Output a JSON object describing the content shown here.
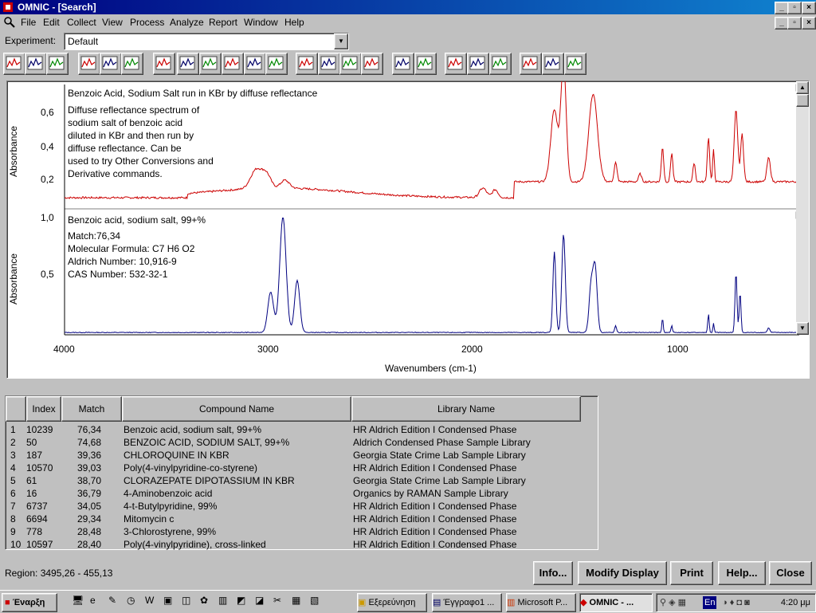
{
  "window": {
    "title": "OMNIC - [Search]"
  },
  "menu": [
    "File",
    "Edit",
    "Collect",
    "View",
    "Process",
    "Analyze",
    "Report",
    "Window",
    "Help"
  ],
  "experiment": {
    "label": "Experiment:",
    "value": "Default"
  },
  "spectrum_top": {
    "title": "Benzoic Acid, Sodium Salt run in KBr by diffuse reflectance",
    "description": [
      "Diffuse reflectance spectrum of",
      "sodium salt of benzoic acid",
      "diluted in KBr and then run by",
      "diffuse reflectance. Can be",
      "used to try Other Conversions and",
      "Derivative commands."
    ],
    "ylabel": "Absorbance",
    "yticks": [
      "0,6",
      "0,4",
      "0,2"
    ],
    "color": "#cc0000"
  },
  "spectrum_bottom": {
    "title": "Benzoic acid, sodium salt, 99+%",
    "match": "Match:76,34",
    "formula": "Molecular Formula:  C7 H6 O2",
    "aldrich": "Aldrich Number:  10,916-9",
    "cas": "CAS Number:  532-32-1",
    "ylabel": "Absorbance",
    "yticks": [
      "1,0",
      "0,5"
    ],
    "color": "#000080"
  },
  "xaxis": {
    "label": "Wavenumbers (cm-1)",
    "ticks": [
      "4000",
      "3000",
      "2000",
      "1000"
    ]
  },
  "table": {
    "headers": [
      "Index",
      "Match",
      "Compound Name",
      "Library Name"
    ],
    "rows": [
      {
        "n": "1",
        "index": "10239",
        "match": "76,34",
        "name": "Benzoic acid, sodium salt, 99+%",
        "lib": "HR Aldrich Edition I Condensed Phase"
      },
      {
        "n": "2",
        "index": "50",
        "match": "74,68",
        "name": "BENZOIC ACID, SODIUM SALT, 99+%",
        "lib": "Aldrich Condensed Phase Sample Library"
      },
      {
        "n": "3",
        "index": "187",
        "match": "39,36",
        "name": "CHLOROQUINE IN KBR",
        "lib": "Georgia State Crime Lab Sample Library"
      },
      {
        "n": "4",
        "index": "10570",
        "match": "39,03",
        "name": "Poly(4-vinylpyridine-co-styrene)",
        "lib": "HR Aldrich Edition I Condensed Phase"
      },
      {
        "n": "5",
        "index": "61",
        "match": "38,70",
        "name": "CLORAZEPATE DIPOTASSIUM IN KBR",
        "lib": "Georgia State Crime Lab Sample Library"
      },
      {
        "n": "6",
        "index": "16",
        "match": "36,79",
        "name": "4-Aminobenzoic acid",
        "lib": "Organics by RAMAN Sample Library"
      },
      {
        "n": "7",
        "index": "6737",
        "match": "34,05",
        "name": "4-t-Butylpyridine, 99%",
        "lib": "HR Aldrich Edition I Condensed Phase"
      },
      {
        "n": "8",
        "index": "6694",
        "match": "29,34",
        "name": "Mitomycin c",
        "lib": "HR Aldrich Edition I Condensed Phase"
      },
      {
        "n": "9",
        "index": "778",
        "match": "28,48",
        "name": "3-Chlorostyrene, 99%",
        "lib": "HR Aldrich Edition I Condensed Phase"
      },
      {
        "n": "10",
        "index": "10597",
        "match": "28,40",
        "name": "Poly(4-vinylpyridine), cross-linked",
        "lib": "HR Aldrich Edition I Condensed Phase"
      }
    ]
  },
  "region": "Region:  3495,26  -  455,13",
  "buttons": {
    "info": "Info...",
    "modify": "Modify Display",
    "print": "Print",
    "help": "Help...",
    "close": "Close"
  },
  "taskbar": {
    "start": "Έναρξη",
    "tasks": [
      "Εξερεύνηση",
      "Έγγραφο1 ...",
      "Microsoft P...",
      "OMNIC - ..."
    ],
    "lang": "En",
    "clock": "4:20 μμ"
  }
}
